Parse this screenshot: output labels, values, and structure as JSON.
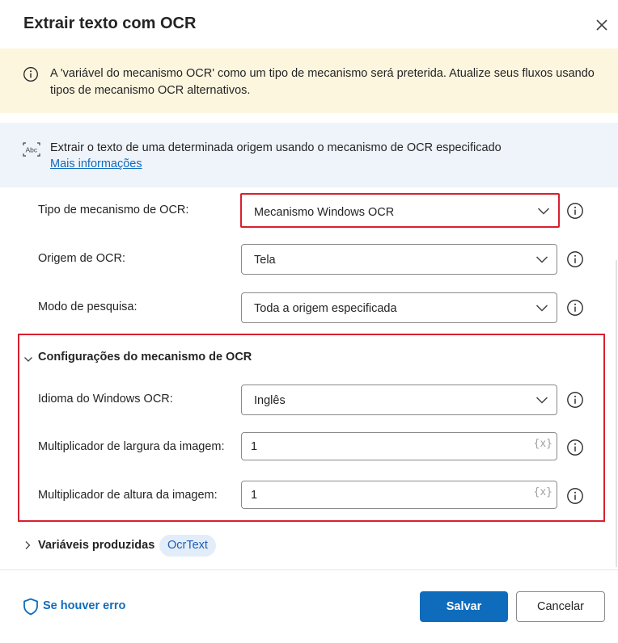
{
  "dialog": {
    "title": "Extrair texto com OCR"
  },
  "warning": {
    "text": "A 'variável do mecanismo OCR' como um tipo de mecanismo será preterida. Atualize seus fluxos usando tipos de mecanismo OCR alternativos."
  },
  "info": {
    "text": "Extrair o texto de uma determinada origem usando o mecanismo de OCR especificado",
    "link": "Mais informações"
  },
  "fields": {
    "engine_type": {
      "label": "Tipo de mecanismo de OCR:",
      "value": "Mecanismo Windows OCR"
    },
    "ocr_source": {
      "label": "Origem de OCR:",
      "value": "Tela"
    },
    "search_mode": {
      "label": "Modo de pesquisa:",
      "value": "Toda a origem especificada"
    }
  },
  "engine_settings": {
    "title": "Configurações do mecanismo de OCR",
    "language": {
      "label": "Idioma do Windows OCR:",
      "value": "Inglês"
    },
    "width_multiplier": {
      "label": "Multiplicador de largura da imagem:",
      "value": "1",
      "token": "{x}"
    },
    "height_multiplier": {
      "label": "Multiplicador de altura da imagem:",
      "value": "1",
      "token": "{x}"
    }
  },
  "variables": {
    "label": "Variáveis produzidas",
    "items": [
      "OcrText"
    ]
  },
  "footer": {
    "error_link": "Se houver erro",
    "save": "Salvar",
    "cancel": "Cancelar"
  },
  "colors": {
    "accent": "#0f6cbd",
    "warning_bg": "#fdf6df",
    "info_bg": "#eff4fb",
    "highlight_red": "#d82030"
  }
}
